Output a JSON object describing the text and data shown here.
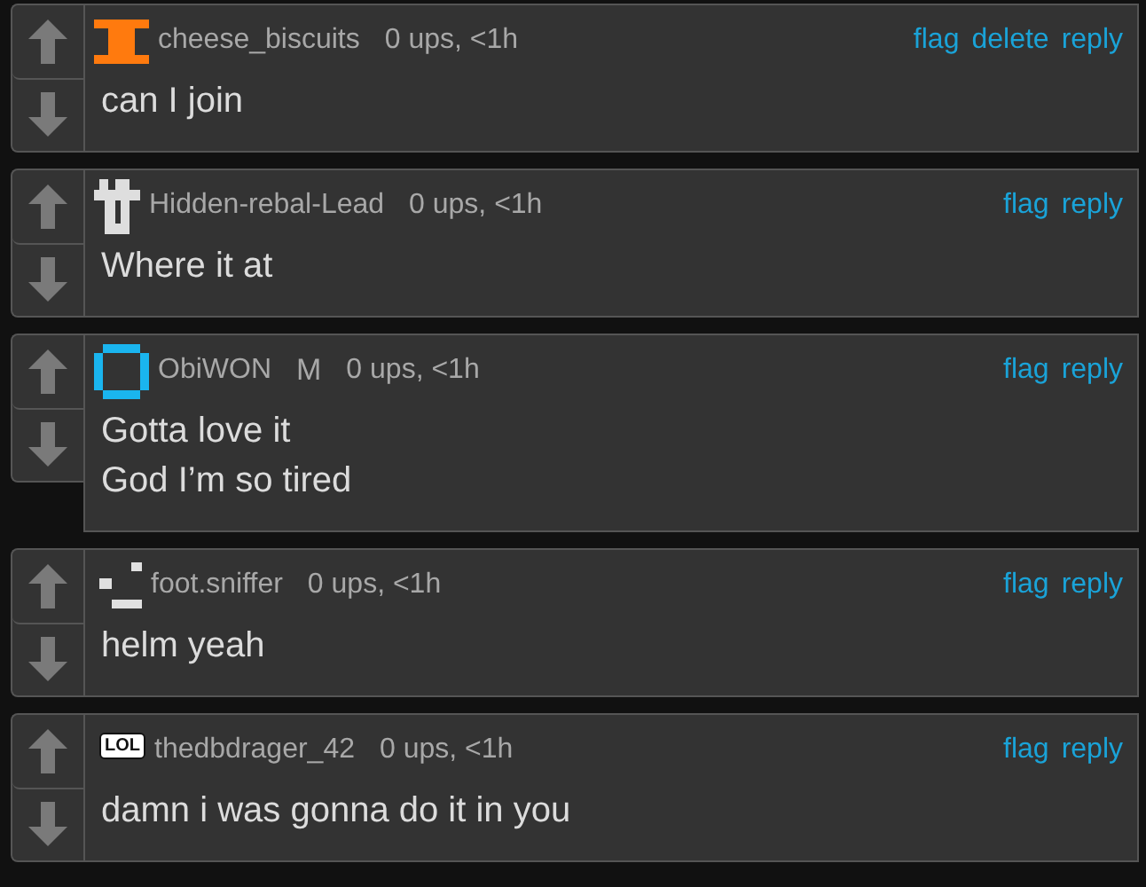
{
  "comments": [
    {
      "avatar": {
        "kind": "orange-beam"
      },
      "user": "cheese_biscuits",
      "meta": "0 ups, <1h",
      "actions": [
        "flag",
        "delete",
        "reply"
      ],
      "lines": [
        "can I join"
      ]
    },
    {
      "avatar": {
        "kind": "white-block"
      },
      "user": "Hidden-rebal-Lead",
      "meta": "0 ups, <1h",
      "actions": [
        "flag",
        "reply"
      ],
      "lines": [
        "Where it at"
      ]
    },
    {
      "avatar": {
        "kind": "blue-ring"
      },
      "user": "ObiWON",
      "badge": "M",
      "meta": "0 ups, <1h",
      "actions": [
        "flag",
        "reply"
      ],
      "lines": [
        "Gotta love it",
        "God I’m so tired"
      ]
    },
    {
      "avatar": {
        "kind": "white-dashes"
      },
      "user": "foot.sniffer",
      "meta": "0 ups, <1h",
      "actions": [
        "flag",
        "reply"
      ],
      "lines": [
        "helm yeah"
      ]
    },
    {
      "avatar": {
        "kind": "speech-bubble",
        "text": "LOL"
      },
      "user": "thedbdrager_42",
      "meta": "0 ups, <1h",
      "actions": [
        "flag",
        "reply"
      ],
      "lines": [
        "damn i was gonna do it in you"
      ]
    }
  ]
}
